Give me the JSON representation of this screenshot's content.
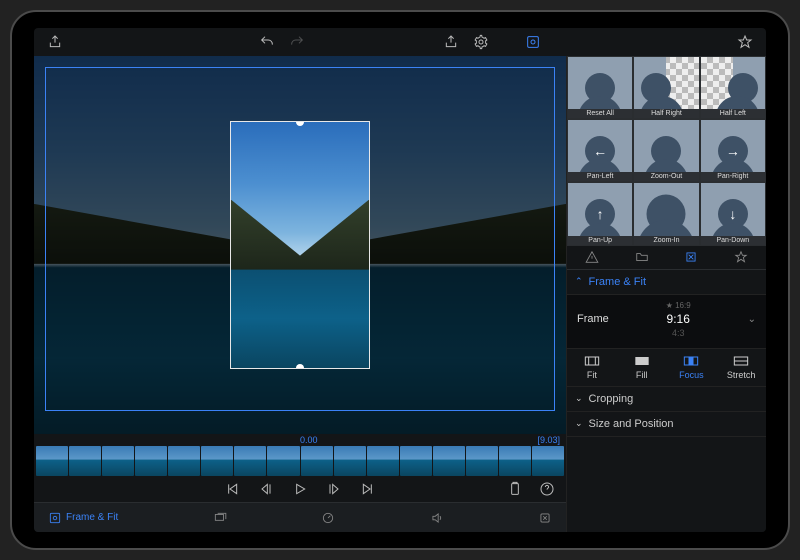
{
  "presets": {
    "row1": [
      "Reset All",
      "Half Right",
      "Half Left"
    ],
    "row2": [
      "Pan-Left",
      "Zoom-Out",
      "Pan-Right"
    ],
    "row3": [
      "Pan-Up",
      "Zoom-In",
      "Pan-Down"
    ]
  },
  "sections": {
    "frame_fit": "Frame & Fit",
    "cropping": "Cropping",
    "size_pos": "Size and Position"
  },
  "frame": {
    "label": "Frame",
    "opt_top": "16:9",
    "opt_sel": "9:16",
    "opt_bot": "4:3"
  },
  "modes": {
    "fit": "Fit",
    "fill": "Fill",
    "focus": "Focus",
    "stretch": "Stretch"
  },
  "timeline": {
    "start": "0.00",
    "end": "[9.03]"
  },
  "bottom_tabs": {
    "frame_fit": "Frame & Fit"
  }
}
